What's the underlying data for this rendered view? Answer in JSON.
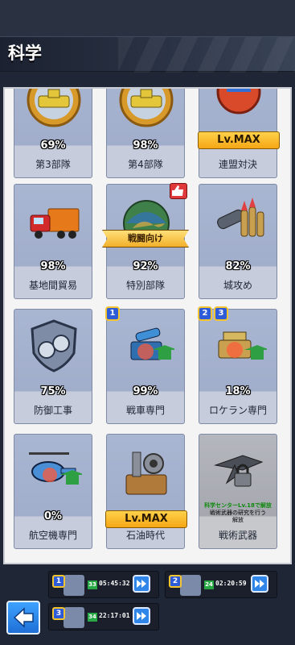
{
  "page": {
    "title": "科学"
  },
  "cards": [
    {
      "id": "c1",
      "name": "第3部隊",
      "percent": "69%"
    },
    {
      "id": "c2",
      "name": "第4部隊",
      "percent": "98%"
    },
    {
      "id": "c3",
      "name": "連盟対決",
      "level": "Lv.MAX"
    },
    {
      "id": "c4",
      "name": "基地間貿易",
      "percent": "98%"
    },
    {
      "id": "c5",
      "name": "特別部隊",
      "percent": "92%",
      "ribbon": "戦闘向け"
    },
    {
      "id": "c6",
      "name": "城攻め",
      "percent": "82%"
    },
    {
      "id": "c7",
      "name": "防御工事",
      "percent": "75%"
    },
    {
      "id": "c8",
      "name": "戦車専門",
      "percent": "99%",
      "badges": [
        "1"
      ]
    },
    {
      "id": "c9",
      "name": "ロケラン専門",
      "percent": "18%",
      "badges": [
        "2",
        "3"
      ]
    },
    {
      "id": "c10",
      "name": "航空機専門",
      "percent": "0%"
    },
    {
      "id": "c11",
      "name": "石油時代",
      "level": "Lv.MAX"
    },
    {
      "id": "c12",
      "name": "戦術武器",
      "lock_line1": "科学センターLv.18で解放",
      "lock_line2": "戦術武器の研究を行う",
      "lock_line3": "解放"
    }
  ],
  "queue": [
    {
      "slot": "1",
      "level": "33",
      "time": "05:45:32"
    },
    {
      "slot": "2",
      "level": "24",
      "time": "02:20:59"
    },
    {
      "slot": "3",
      "level": "34",
      "time": "22:17:01"
    }
  ],
  "colors": {
    "accent": "#2f86e8",
    "gold": "#f5a615",
    "progress": "#28a745"
  },
  "icons": {
    "back": "back-arrow-icon",
    "fast_forward": "fast-forward-icon",
    "thumbs_up": "thumbs-up-icon",
    "lock": "lock-icon"
  }
}
